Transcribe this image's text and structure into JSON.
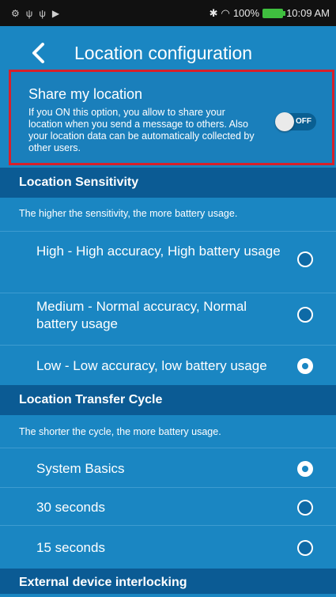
{
  "status_bar": {
    "left_icons": [
      "⚙",
      "ψ",
      "ψ",
      "▶"
    ],
    "battery": "100%",
    "time": "10:09 AM"
  },
  "header": {
    "title": "Location configuration"
  },
  "share": {
    "title": "Share my location",
    "description": "If you ON this option, you allow to share your location when you send a message to others. Also your location data can be automatically collected by other users.",
    "toggle_label": "OFF",
    "enabled": false
  },
  "sensitivity": {
    "heading": "Location Sensitivity",
    "note": "The higher the sensitivity, the more battery usage.",
    "options": [
      {
        "label": "High - High accuracy, High battery usage",
        "selected": false
      },
      {
        "label": "Medium - Normal accuracy, Normal battery usage",
        "selected": false
      },
      {
        "label": "Low - Low accuracy, low battery usage",
        "selected": true
      }
    ]
  },
  "transfer": {
    "heading": "Location Transfer Cycle",
    "note": "The shorter the cycle, the more battery usage.",
    "options": [
      {
        "label": "System Basics",
        "selected": true
      },
      {
        "label": "30 seconds",
        "selected": false
      },
      {
        "label": "15 seconds",
        "selected": false
      }
    ]
  },
  "external": {
    "heading": "External device interlocking"
  },
  "colors": {
    "background": "#1a86c2",
    "section": "#0b5b94",
    "highlight_border": "#d8202a"
  }
}
